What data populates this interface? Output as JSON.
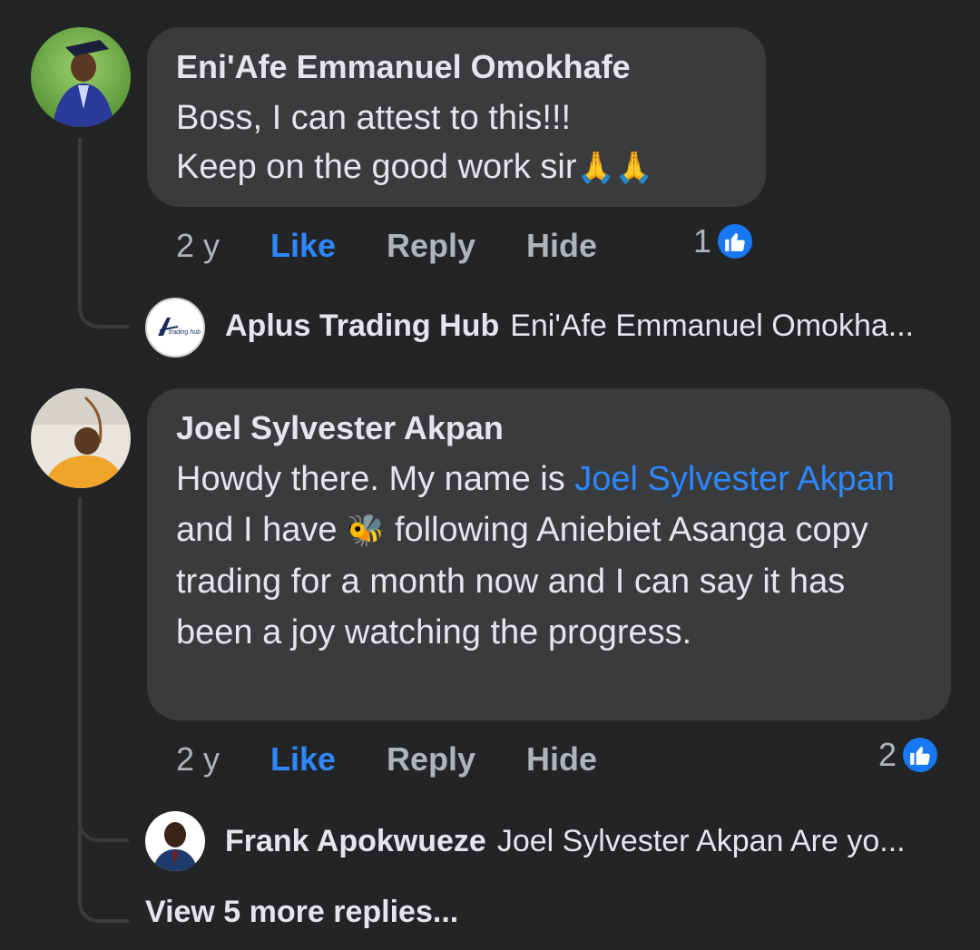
{
  "comments": [
    {
      "author": "Eni'Afe Emmanuel Omokhafe",
      "text_line1": "Boss, I can attest to this!!!",
      "text_line2": "Keep on the good work sir",
      "emoji": "🙏🙏",
      "time": "2 y",
      "like_label": "Like",
      "reply_label": "Reply",
      "hide_label": "Hide",
      "reaction_count": "1",
      "reply_preview": {
        "author": "Aplus Trading Hub",
        "text": "Eni'Afe Emmanuel Omokha...",
        "avatar_logo_text": "trading hub"
      }
    },
    {
      "author": "Joel Sylvester Akpan",
      "text_before_mention": "Howdy there. My name is ",
      "mention": "Joel Sylvester Akpan",
      "text_after_mention": " and I have",
      "emoji": "🐝",
      "text_rest": " following Aniebiet Asanga copy trading for a month now and I can say it has been a joy watching the progress.",
      "time": "2 y",
      "like_label": "Like",
      "reply_label": "Reply",
      "hide_label": "Hide",
      "reaction_count": "2",
      "reply_preview": {
        "author": "Frank Apokwueze",
        "text": "Joel Sylvester Akpan Are yo..."
      },
      "view_more": "View 5 more replies..."
    }
  ],
  "colors": {
    "background": "#232425",
    "bubble": "#3a3b3c",
    "text": "#e4e6eb",
    "muted": "#b0b3b8",
    "link": "#2d88ff",
    "like_badge": "#1877f2"
  },
  "icons": {
    "like_badge": "thumbs-up-icon"
  }
}
